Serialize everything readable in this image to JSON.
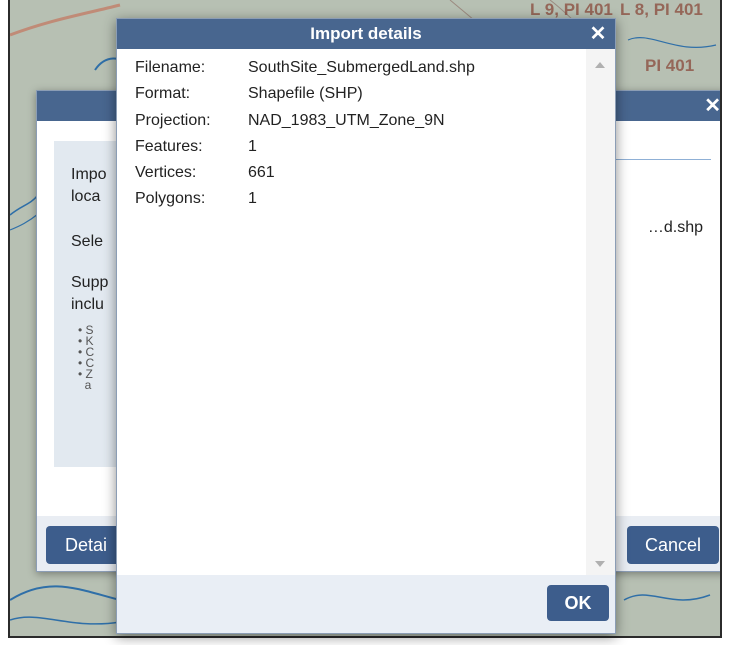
{
  "map": {
    "labels": [
      "L 9, PI 401",
      "L 8, PI 401",
      "PI 401"
    ]
  },
  "background_dialog": {
    "text_lines": [
      "Impo",
      "loca",
      "Sele",
      "Supp",
      "inclu"
    ],
    "bullet_letters": [
      "S",
      "K",
      "C",
      "C",
      "Z",
      "a"
    ],
    "filename_fragment": "…d.shp",
    "details_button": "Detai",
    "cancel_button": "Cancel"
  },
  "dialog": {
    "title": "Import details",
    "rows": [
      {
        "label": "Filename:",
        "value": "SouthSite_SubmergedLand.shp"
      },
      {
        "label": "Format:",
        "value": "Shapefile (SHP)"
      },
      {
        "label": "Projection:",
        "value": "NAD_1983_UTM_Zone_9N"
      },
      {
        "label": "Features:",
        "value": "1"
      },
      {
        "label": "Vertices:",
        "value": "661"
      },
      {
        "label": "Polygons:",
        "value": "1"
      }
    ],
    "ok_button": "OK"
  },
  "icons": {
    "close": "close-icon",
    "scroll_up": "scroll-up-arrow-icon",
    "scroll_down": "scroll-down-arrow-icon"
  },
  "colors": {
    "titlebar": "#48668f",
    "button": "#3d5d8c",
    "footer": "#e9eef5"
  }
}
